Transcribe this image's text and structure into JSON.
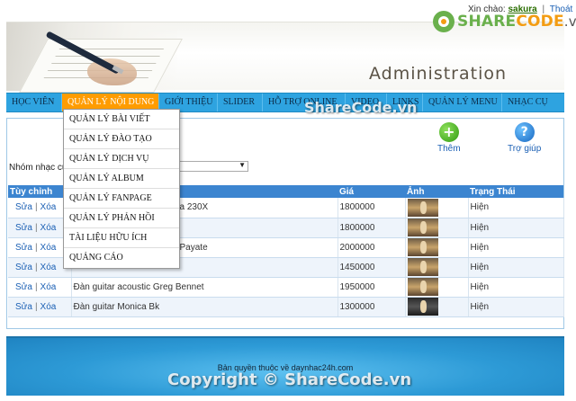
{
  "header": {
    "greeting": "Xin chào:",
    "username": "sakura",
    "separator": "|",
    "logout": "Thoát",
    "title": "Administration"
  },
  "logo": {
    "brand_left": "SHARE",
    "brand_mid": "CODE",
    "brand_tld": ".vn"
  },
  "nav": {
    "items": [
      {
        "label": "HỌC VIÊN"
      },
      {
        "label": "QUẢN LÝ NỘI DUNG",
        "active": true
      },
      {
        "label": "GIỚI THIỆU"
      },
      {
        "label": "SLIDER"
      },
      {
        "label": "HỖ TRỢ ONLINE"
      },
      {
        "label": "VIDEO"
      },
      {
        "label": "LINKS"
      },
      {
        "label": "QUẢN LÝ MENU"
      },
      {
        "label": "NHẠC CỤ"
      }
    ]
  },
  "dropdown": {
    "items": [
      "QUẢN LÝ BÀI VIẾT",
      "QUẢN LÝ ĐÀO TẠO",
      "QUẢN LÝ DỊCH VỤ",
      "QUẢN LÝ ALBUM",
      "QUẢN LÝ FANPAGE",
      "QUẢN LÝ PHẢN HỒI",
      "TÀI LIỆU HỮU ÍCH",
      "QUẢNG CÁO"
    ]
  },
  "toolbar": {
    "add_label": "Thêm",
    "add_icon": "+",
    "help_label": "Trợ giúp",
    "help_icon": "?"
  },
  "filter": {
    "label": "Nhóm nhạc cụ",
    "value": ""
  },
  "table": {
    "columns": {
      "actions": "Tùy chỉnh",
      "name": "",
      "price": "Giá",
      "image": "Ảnh",
      "status": "Trạng Thái"
    },
    "edit_label": "Sửa",
    "delete_label": "Xóa",
    "rows": [
      {
        "name": "a 230X",
        "price": "1800000",
        "status": "Hiện",
        "thumb": "light"
      },
      {
        "name": "",
        "price": "1800000",
        "status": "Hiện",
        "thumb": "light"
      },
      {
        "name": "Payate",
        "price": "2000000",
        "status": "Hiện",
        "thumb": "light"
      },
      {
        "name": "",
        "price": "1450000",
        "status": "Hiện",
        "thumb": "light"
      },
      {
        "name": "Đàn guitar acoustic Greg Bennet",
        "price": "1950000",
        "status": "Hiện",
        "thumb": "light"
      },
      {
        "name": "Đàn guitar Monica Bk",
        "price": "1300000",
        "status": "Hiện",
        "thumb": "dark"
      }
    ]
  },
  "footer": {
    "copyright": "Bản quyền thuộc về  daynhac24h.com"
  },
  "watermark": {
    "mid": "ShareCode.vn",
    "bottom": "Copyright © ShareCode.vn"
  }
}
